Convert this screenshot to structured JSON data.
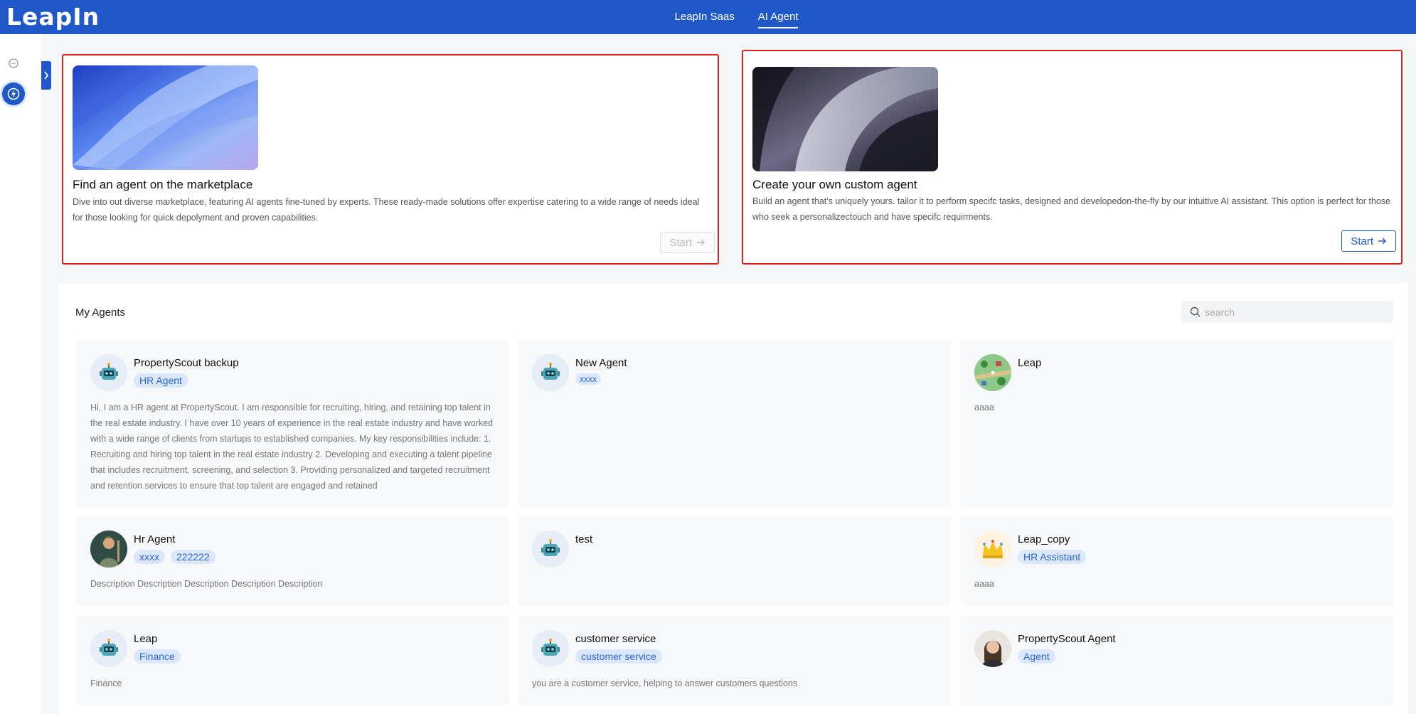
{
  "app": {
    "logo": "LeapIn"
  },
  "topnav": {
    "items": [
      {
        "label": "LeapIn Saas"
      },
      {
        "label": "AI Agent"
      }
    ]
  },
  "features": [
    {
      "title": "Find an agent on the marketplace",
      "desc": "Dive into out diverse marketplace, featuring AI agents fine-tuned by experts. These ready-made solutions offer expertise catering to a wide range of needs ideal for those looking for quick depolyment and proven capabilities.",
      "button": "Start"
    },
    {
      "title": "Create your own custom agent",
      "desc": "Build an agent that's uniquely yours. tailor it to perform specifc tasks, designed and developedon-the-fly by our intuitive AI assistant. This option is perfect for those who seek a personalizectouch and have specifc requirments.",
      "button": "Start"
    }
  ],
  "my_agents": {
    "title": "My Agents",
    "search_placeholder": "search",
    "agents": [
      {
        "name": "PropertyScout backup",
        "avatar": "robot-icon",
        "tags": [
          "HR Agent"
        ],
        "desc": "Hi, I am a HR agent at PropertyScout. I am responsible for recruiting, hiring, and retaining top talent in the real estate industry. I have over 10 years of experience in the real estate industry and have worked with a wide range of clients from startups to established companies. My key responsibilities include: 1. Recruiting and hiring top talent in the real estate industry 2. Developing and executing a talent pipeline that includes recruitment, screening, and selection 3. Providing personalized and targeted recruitment and retention services to ensure that top talent are engaged and retained"
      },
      {
        "name": "New Agent",
        "avatar": "robot-icon",
        "tags": [
          "xxxx"
        ],
        "desc": ""
      },
      {
        "name": "Leap",
        "avatar": "map-avatar",
        "tags": [],
        "desc": "aaaa"
      },
      {
        "name": "Hr Agent",
        "avatar": "fantasy-avatar",
        "tags": [
          "xxxx",
          "222222"
        ],
        "desc": "Description Description Description Description Description"
      },
      {
        "name": "test",
        "avatar": "robot-icon",
        "tags": [],
        "desc": ""
      },
      {
        "name": "Leap_copy",
        "avatar": "crown-avatar",
        "tags": [
          "HR Assistant"
        ],
        "desc": "aaaa"
      },
      {
        "name": "Leap",
        "avatar": "robot-icon",
        "tags": [
          "Finance"
        ],
        "desc": "Finance"
      },
      {
        "name": "customer service",
        "avatar": "robot-icon",
        "tags": [
          "customer service"
        ],
        "desc": "you are a customer service, helping to answer customers questions"
      },
      {
        "name": "PropertyScout Agent",
        "avatar": "woman-avatar",
        "tags": [
          "Agent"
        ],
        "desc": ""
      }
    ]
  }
}
